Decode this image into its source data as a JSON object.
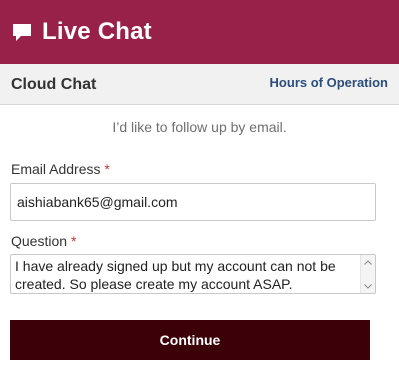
{
  "header": {
    "title": "Live Chat",
    "icon": "chat-bubble-icon",
    "background_color": "#98214a"
  },
  "subbar": {
    "title": "Cloud Chat",
    "hours_link": "Hours of Operation"
  },
  "form": {
    "intro": "I’d like to follow up by email.",
    "email": {
      "label": "Email Address",
      "required_marker": "*",
      "value": "aishiabank65@gmail.com"
    },
    "question": {
      "label": "Question",
      "required_marker": "*",
      "value": "I have already signed up but my account can not be created. So please create my account ASAP."
    },
    "submit_label": "Continue",
    "submit_color": "#3c0009"
  }
}
